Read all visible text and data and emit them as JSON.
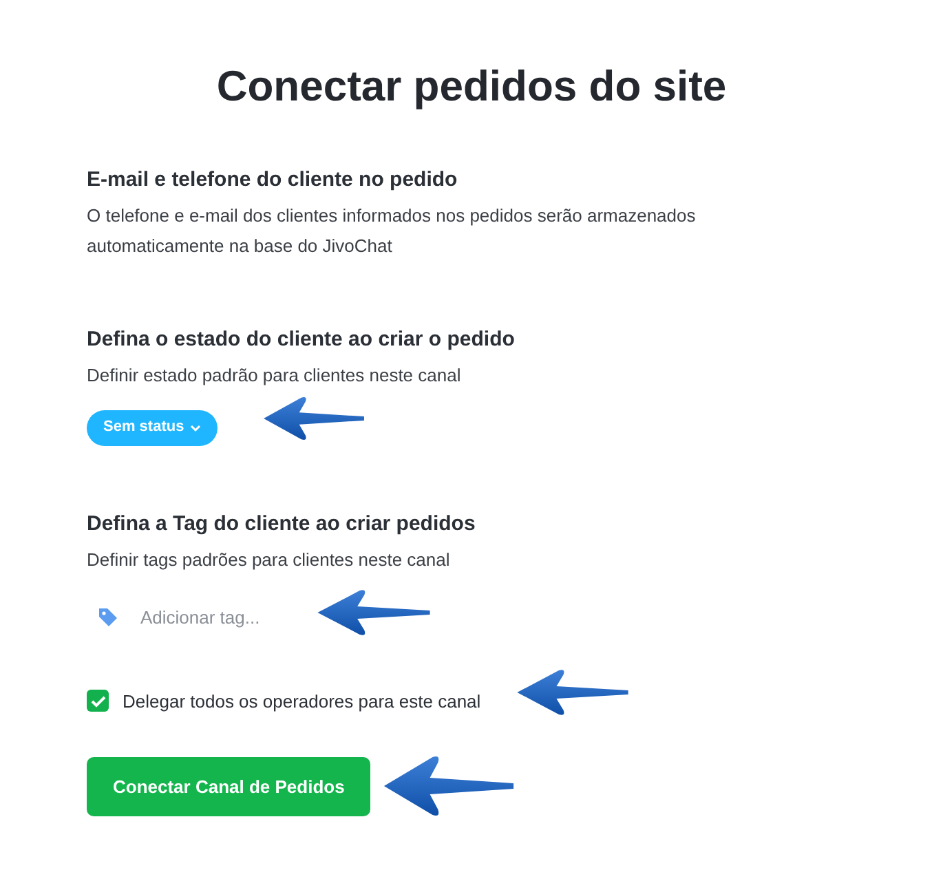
{
  "title": "Conectar pedidos do site",
  "sections": [
    {
      "heading": "E-mail e telefone do cliente no pedido",
      "description": "O telefone e e-mail dos clientes informados nos pedidos serão armazenados automaticamente na base do JivoChat"
    },
    {
      "heading": "Defina o estado do cliente ao criar o pedido",
      "description": "Definir estado padrão para clientes neste canal",
      "status_dropdown": {
        "value": "Sem status"
      }
    },
    {
      "heading": "Defina a Tag do cliente ao criar pedidos",
      "description": "Definir tags padrões para clientes neste canal",
      "tag_field": {
        "placeholder": "Adicionar tag..."
      }
    }
  ],
  "delegate_checkbox": {
    "label": "Delegar todos os operadores para este canal",
    "checked": true
  },
  "connect_button": {
    "label": "Conectar Canal de Pedidos"
  }
}
